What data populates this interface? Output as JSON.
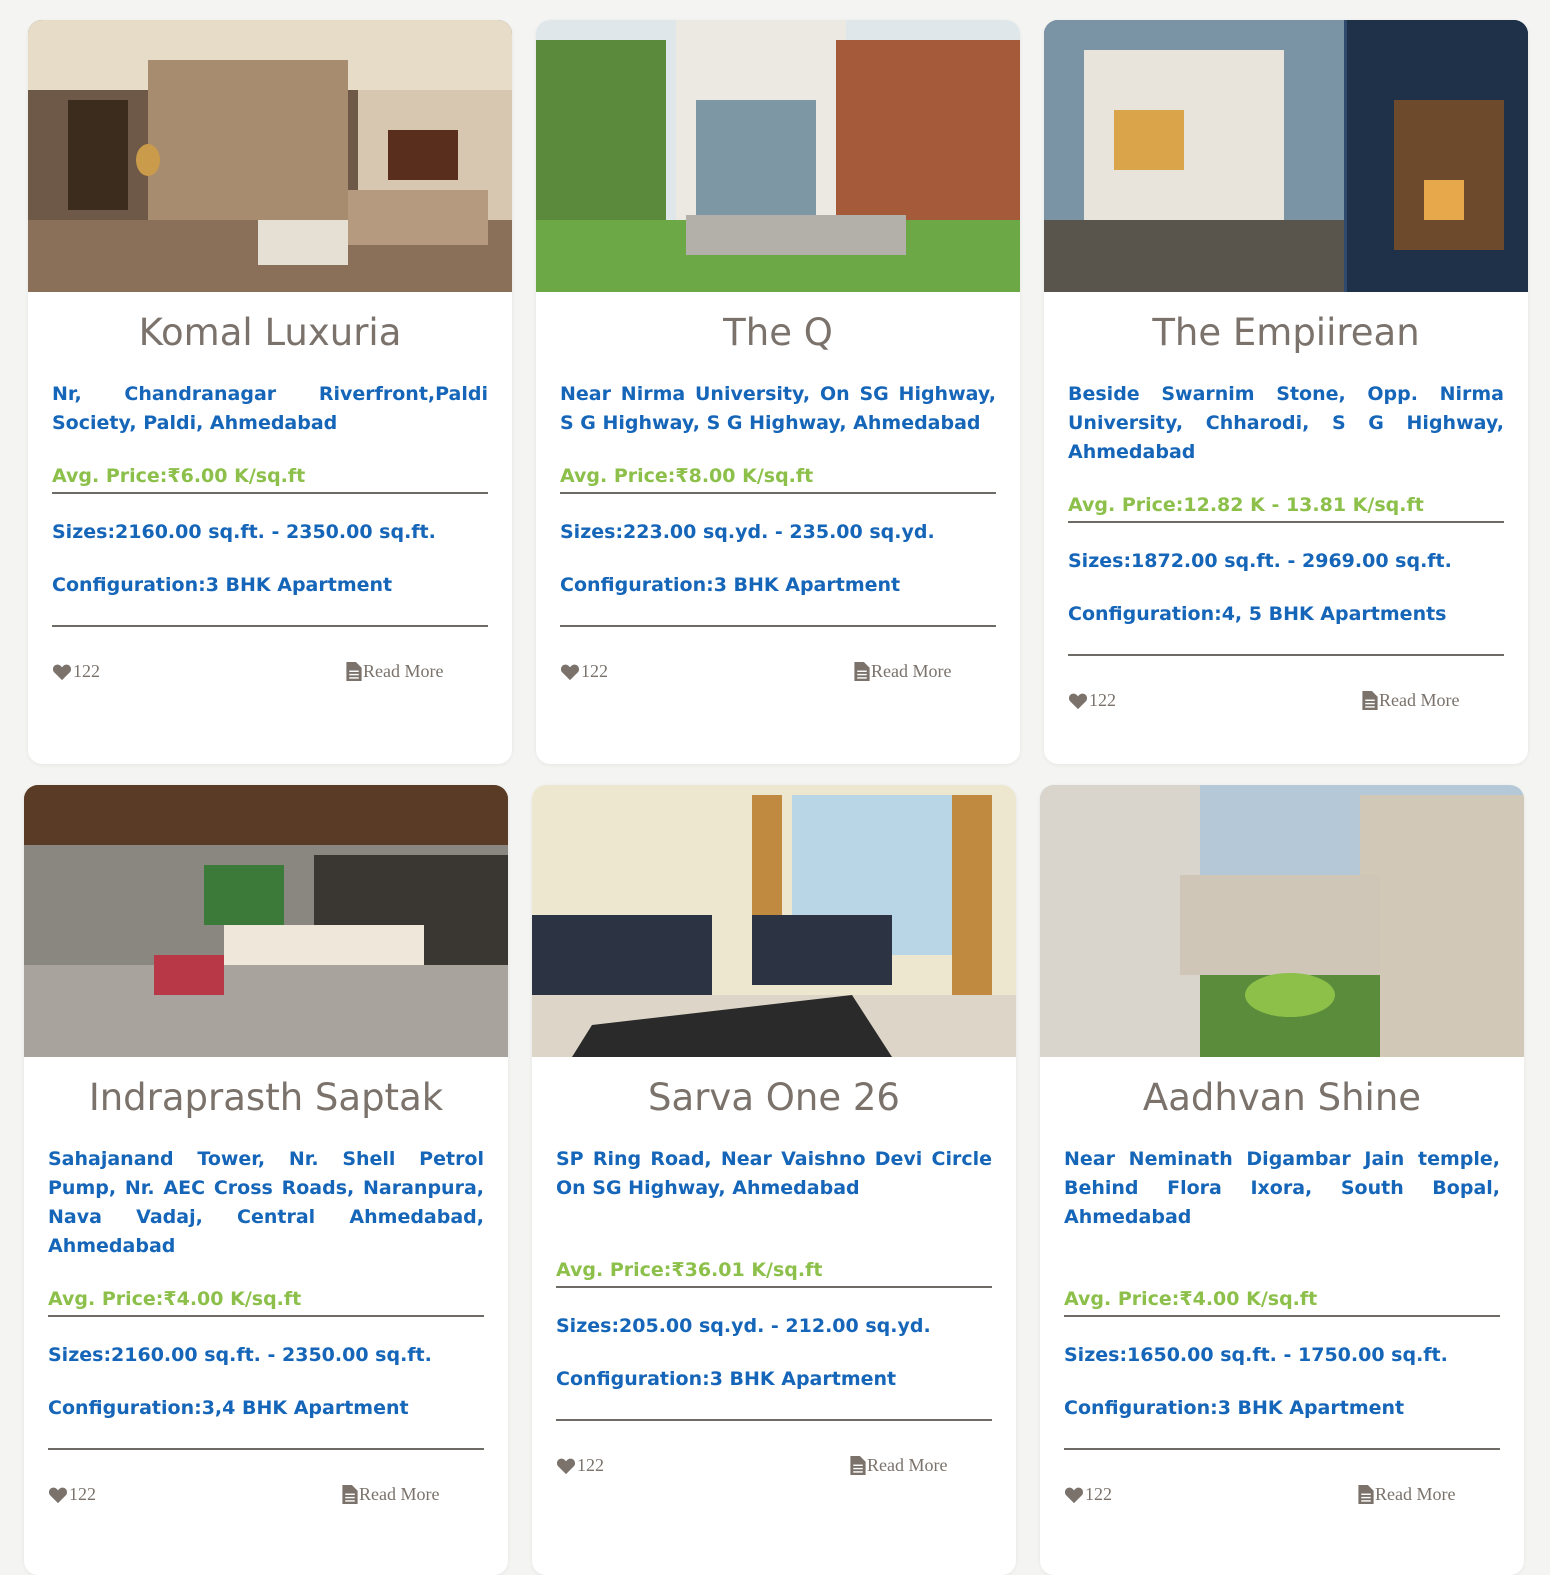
{
  "cards": [
    {
      "title": "Komal Luxuria",
      "address": "Nr, Chandranagar Riverfront,Paldi Society, Paldi, Ahmedabad",
      "price": "Avg. Price:₹6.00 K/sq.ft",
      "sizes": "Sizes:2160.00 sq.ft. - 2350.00 sq.ft.",
      "configuration": "Configuration:3 BHK Apartment",
      "likes": "122",
      "read_more": "Read More",
      "image": "living-room-photo"
    },
    {
      "title": "The Q",
      "address": "Near Nirma University, On SG Highway, S G Highway, S G Highway, Ahmedabad",
      "price": "Avg. Price:₹8.00 K/sq.ft",
      "sizes": "Sizes:223.00 sq.yd. - 235.00 sq.yd.",
      "configuration": "Configuration:3 BHK Apartment",
      "likes": "122",
      "read_more": "Read More",
      "image": "building-garden-photo"
    },
    {
      "title": "The Empiirean",
      "address": "Beside Swarnim Stone, Opp. Nirma University, Chharodi, S G Highway, Ahmedabad",
      "price": "Avg. Price:12.82 K - 13.81 K/sq.ft",
      "sizes": "Sizes:1872.00 sq.ft. - 2969.00 sq.ft.",
      "configuration": "Configuration:4, 5 BHK Apartments",
      "likes": "122",
      "read_more": "Read More",
      "image": "villa-exterior-photo"
    },
    {
      "title": "Indraprasth Saptak",
      "address": "Sahajanand Tower, Nr. Shell Petrol Pump, Nr. AEC Cross Roads, Naranpura, Nava Vadaj, Central Ahmedabad, Ahmedabad",
      "price": "Avg. Price:₹4.00 K/sq.ft",
      "sizes": "Sizes:2160.00 sq.ft. - 2350.00 sq.ft.",
      "configuration": "Configuration:3,4 BHK Apartment",
      "likes": "122",
      "read_more": "Read More",
      "image": "swing-living-room-photo"
    },
    {
      "title": "Sarva One 26",
      "address": "SP Ring Road, Near Vaishno Devi Circle On SG Highway, Ahmedabad",
      "price": "Avg. Price:₹36.01 K/sq.ft",
      "sizes": "Sizes:205.00 sq.yd. - 212.00 sq.yd.",
      "configuration": "Configuration:3 BHK Apartment",
      "likes": "122",
      "read_more": "Read More",
      "image": "sofa-room-photo"
    },
    {
      "title": "Aadhvan Shine",
      "address": "Near Neminath Digambar Jain temple, Behind Flora Ixora, South Bopal, Ahmedabad",
      "price": "Avg. Price:₹4.00 K/sq.ft",
      "sizes": "Sizes:1650.00 sq.ft. - 1750.00 sq.ft.",
      "configuration": "Configuration:3 BHK Apartment",
      "likes": "122",
      "read_more": "Read More",
      "image": "township-aerial-photo"
    }
  ],
  "colors": {
    "title": "#7a726b",
    "address": "#1565b8",
    "price": "#8cc04a",
    "rule": "#6e6a66",
    "background": "#f4f4f2"
  },
  "icons": {
    "likes": "heart-icon",
    "read_more": "document-icon"
  }
}
